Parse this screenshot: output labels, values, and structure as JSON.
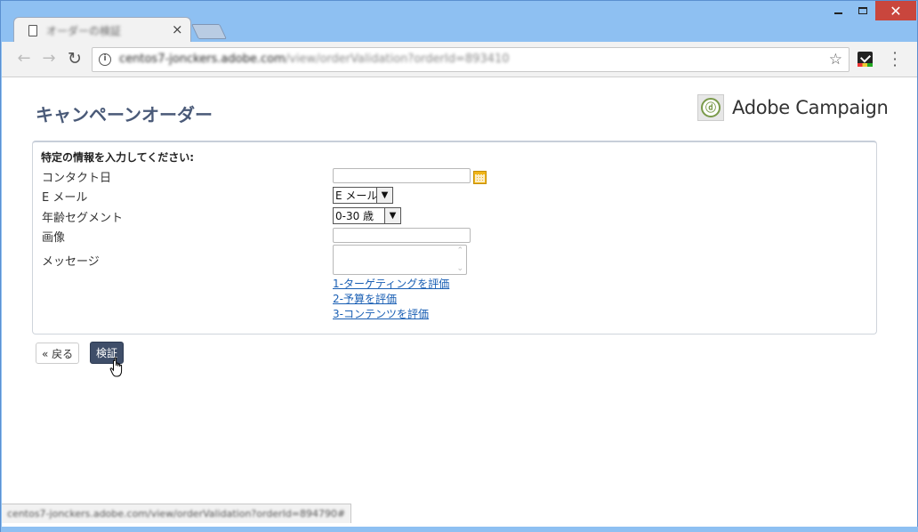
{
  "browser": {
    "tab_title": "オーダーの検証",
    "tab_close": "×",
    "url_host": "centos7-jonckers.adobe.com",
    "url_path": "/view/orderValidation?orderId=893410",
    "info_icon": "i",
    "status_url": "centos7-jonckers.adobe.com/view/orderValidation?orderId=894790#"
  },
  "header": {
    "title": "キャンペーンオーダー",
    "brand": "Adobe Campaign"
  },
  "form": {
    "heading": "特定の情報を入力してください:",
    "fields": {
      "contact_date": {
        "label": "コンタクト日",
        "value": ""
      },
      "email": {
        "label": "E メール",
        "selected": "E メール"
      },
      "age_segment": {
        "label": "年齢セグメント",
        "selected": "0-30 歳"
      },
      "image": {
        "label": "画像",
        "value": ""
      },
      "message": {
        "label": "メッセージ",
        "value": ""
      }
    },
    "links": [
      "1-ターゲティングを評価",
      "2-予算を評価",
      "3-コンテンツを評価"
    ]
  },
  "buttons": {
    "back": "« 戻る",
    "validate": "検証"
  }
}
